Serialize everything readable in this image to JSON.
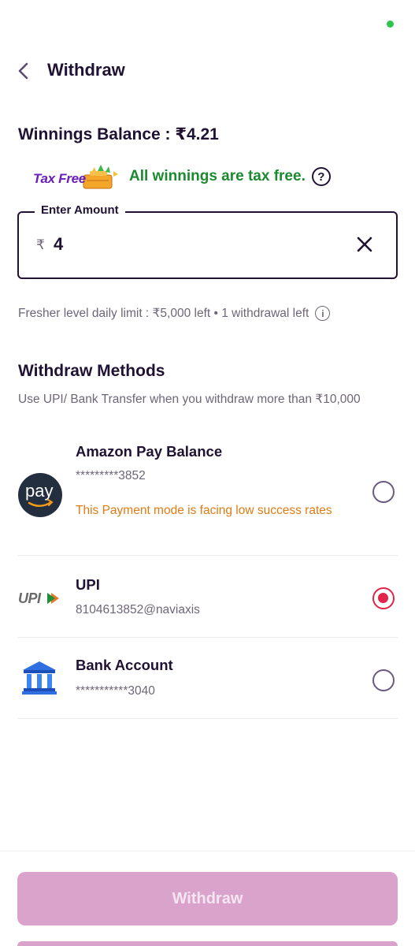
{
  "header": {
    "title": "Withdraw",
    "back_icon": "chevron-left-icon"
  },
  "balance": {
    "label": "Winnings Balance : ₹4.21"
  },
  "tax_free": {
    "badge_text": "Tax Free",
    "message": "All winnings are tax free.",
    "help_icon": "?"
  },
  "amount": {
    "legend": "Enter Amount",
    "currency_symbol": "₹",
    "value": "4",
    "clear_icon": "close-icon"
  },
  "limit": {
    "text": "Fresher level daily limit : ₹5,000 left • 1 withdrawal left",
    "info_icon": "i"
  },
  "methods": {
    "title": "Withdraw Methods",
    "subtitle": "Use UPI/ Bank Transfer when you withdraw more than ₹10,000",
    "items": [
      {
        "name": "Amazon Pay Balance",
        "detail": "*********3852",
        "warning": "This Payment mode is facing low success rates",
        "selected": false,
        "logo_text": "pay"
      },
      {
        "name": "UPI",
        "detail": "8104613852@naviaxis",
        "selected": true,
        "logo_text": "UPI"
      },
      {
        "name": "Bank Account",
        "detail": "***********3040",
        "selected": false
      }
    ]
  },
  "footer": {
    "withdraw_label": "Withdraw"
  },
  "colors": {
    "accent": "#e2244a",
    "button_disabled": "#d9a3cb",
    "success_green": "#1b8a2f",
    "warning_orange": "#e07b14",
    "status_dot": "#2fc44a"
  }
}
